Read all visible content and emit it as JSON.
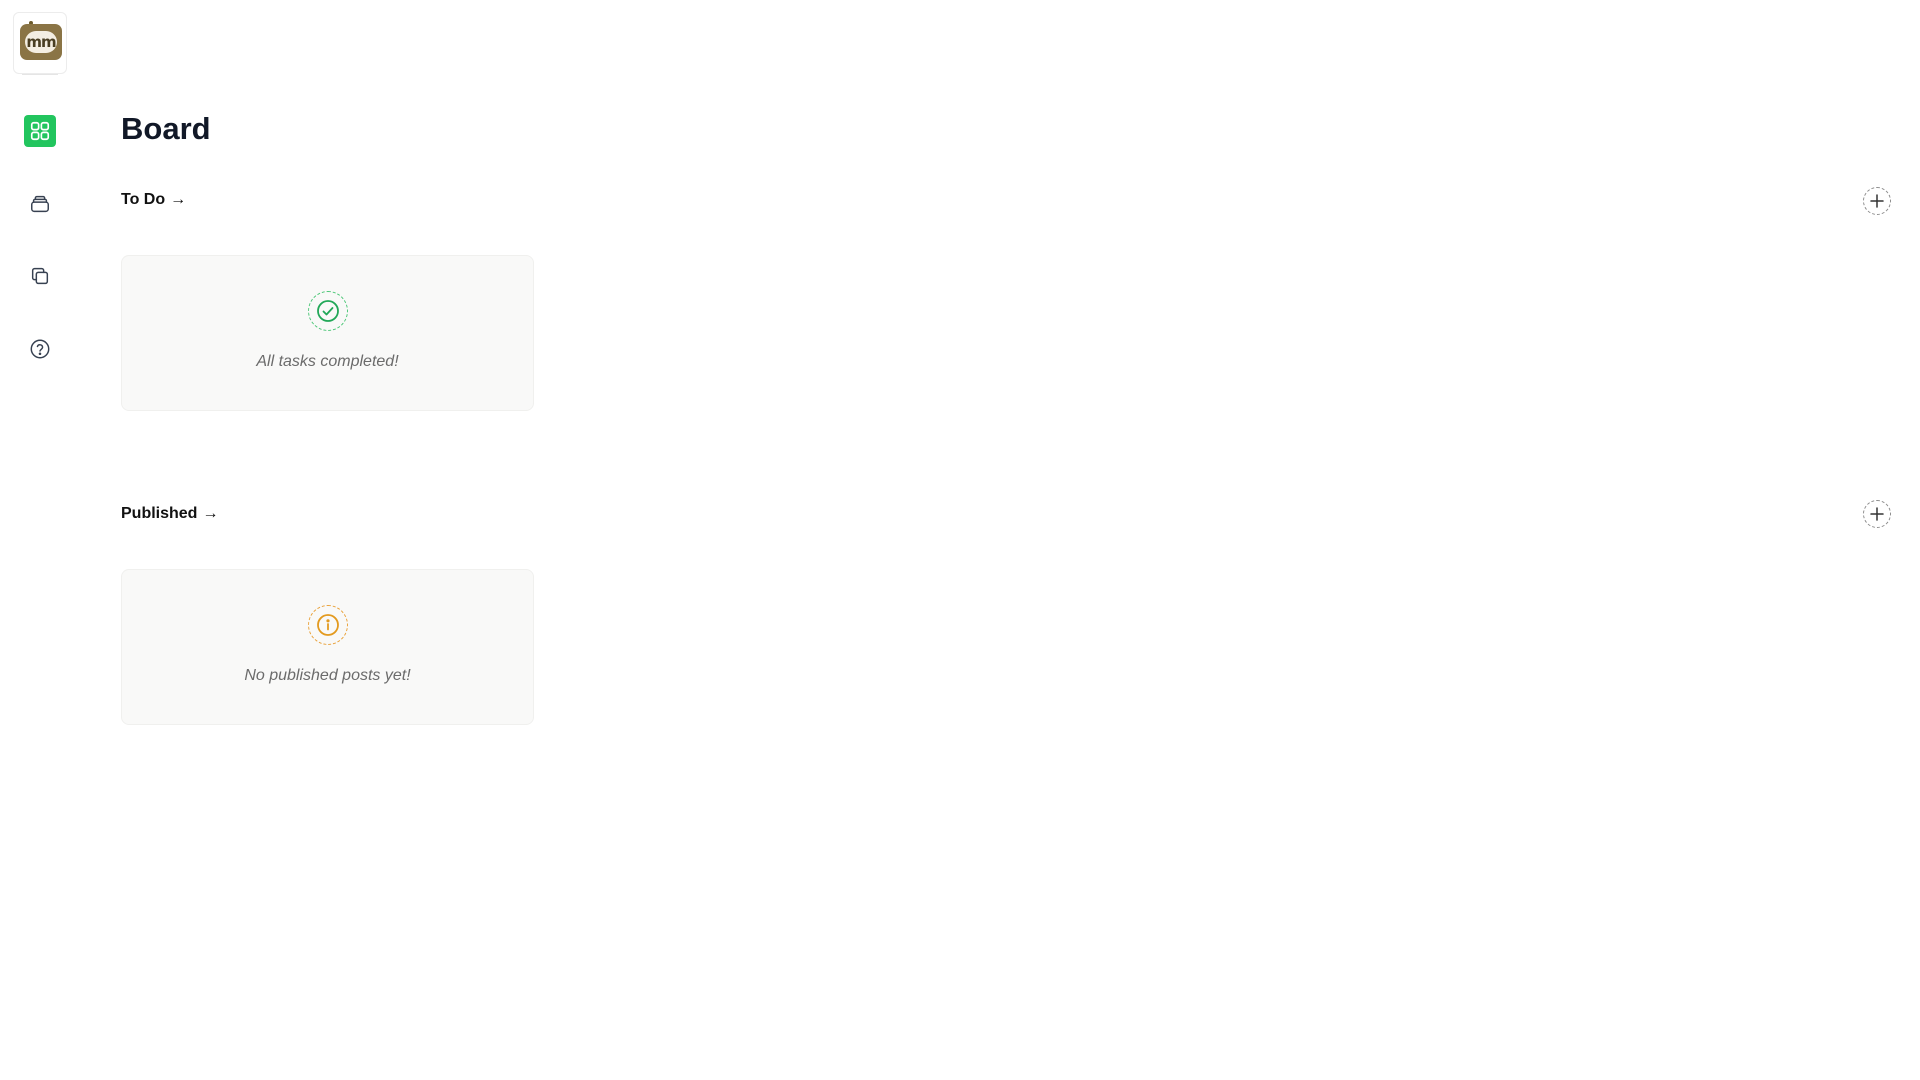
{
  "sidebar": {
    "logo_text": "mm",
    "nav": [
      {
        "id": "board",
        "icon": "grid-icon",
        "active": true
      },
      {
        "id": "inbox",
        "icon": "inbox-icon",
        "active": false
      },
      {
        "id": "copy",
        "icon": "copy-icon",
        "active": false
      },
      {
        "id": "help",
        "icon": "help-circle-icon",
        "active": false
      }
    ]
  },
  "main": {
    "title": "Board",
    "sections": [
      {
        "id": "todo",
        "label": "To Do",
        "arrow": "→",
        "empty_icon": "check-circle-icon",
        "empty_text": "All tasks completed!"
      },
      {
        "id": "published",
        "label": "Published",
        "arrow": "→",
        "empty_icon": "info-circle-icon",
        "empty_text": "No published posts yet!"
      }
    ]
  },
  "colors": {
    "accent": "#22c55e",
    "success": "#22a858",
    "warning": "#e9a23b"
  }
}
